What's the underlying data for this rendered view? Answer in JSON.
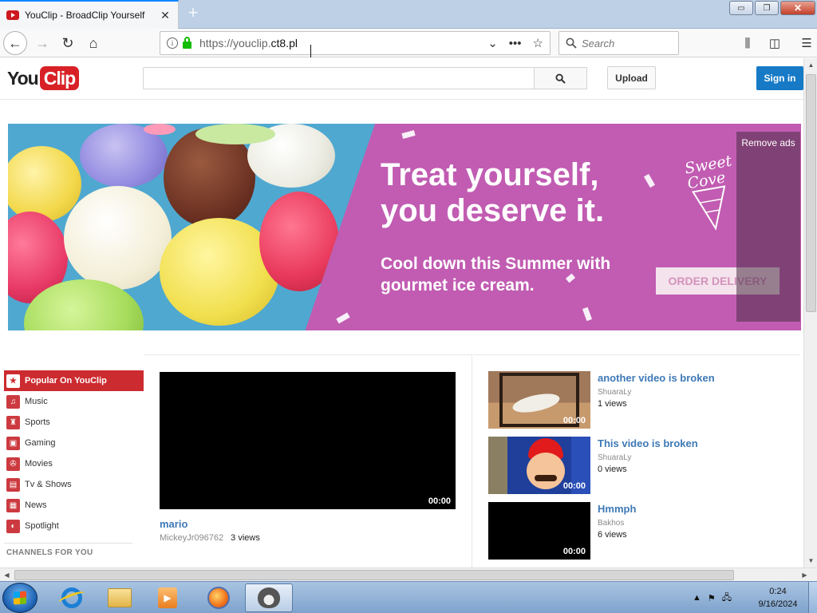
{
  "browser": {
    "tab_title": "YouClip - BroadClip Yourself",
    "tab_close": "✕",
    "new_tab": "+",
    "url_prefix": "https://youclip.",
    "url_host": "ct8.pl",
    "search_placeholder": "Search",
    "window_controls": {
      "minimize": "▭",
      "restore": "❐",
      "close": "✕"
    }
  },
  "site": {
    "logo_you": "You",
    "logo_clip": "Clip",
    "search_value": "",
    "upload_label": "Upload",
    "signin_label": "Sign in"
  },
  "ad": {
    "headline_line1": "Treat yourself,",
    "headline_line2": "you deserve it.",
    "sub_line1": "Cool down this Summer with",
    "sub_line2": "gourmet ice cream.",
    "cta": "ORDER DELIVERY",
    "remove_ads": "Remove ads",
    "brand_line1": "Sweet",
    "brand_line2": "Cove"
  },
  "sidebar": {
    "items": [
      {
        "label": "Popular On YouClip",
        "icon": "star-icon",
        "glyph": "★"
      },
      {
        "label": "Music",
        "icon": "headphones-icon",
        "glyph": "♫"
      },
      {
        "label": "Sports",
        "icon": "trophy-icon",
        "glyph": "♜"
      },
      {
        "label": "Gaming",
        "icon": "gamepad-icon",
        "glyph": "▣"
      },
      {
        "label": "Movies",
        "icon": "film-reel-icon",
        "glyph": "✇"
      },
      {
        "label": "Tv & Shows",
        "icon": "tv-icon",
        "glyph": "▤"
      },
      {
        "label": "News",
        "icon": "newspaper-icon",
        "glyph": "▦"
      },
      {
        "label": "Spotlight",
        "icon": "spotlight-icon",
        "glyph": "◐"
      }
    ],
    "channels_heading": "CHANNELS FOR YOU"
  },
  "main_video": {
    "title": "mario",
    "channel": "MickeyJr096762",
    "views": "3 views",
    "duration": "00:00"
  },
  "related": [
    {
      "title": "another video is broken",
      "channel": "ShuaraLy",
      "views": "1 views",
      "duration": "00:00"
    },
    {
      "title": "This video is broken",
      "channel": "ShuaraLy",
      "views": "0 views",
      "duration": "00:00"
    },
    {
      "title": "Hmmph",
      "channel": "Bakhos",
      "views": "6 views",
      "duration": "00:00"
    }
  ],
  "taskbar": {
    "time": "0:24",
    "date": "9/16/2024"
  }
}
